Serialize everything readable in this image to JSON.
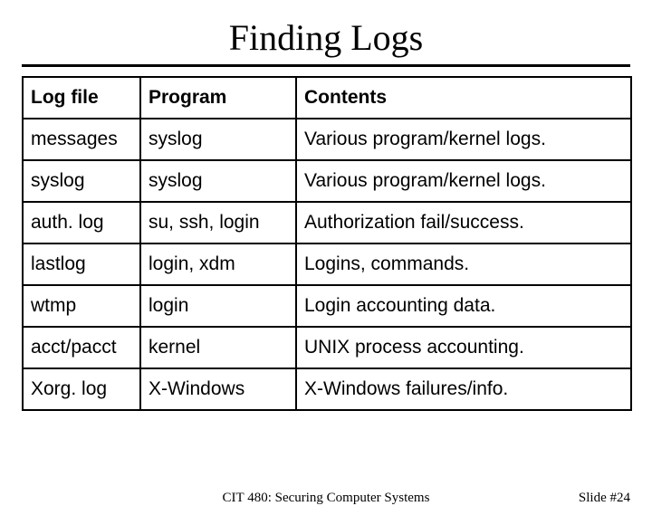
{
  "title": "Finding Logs",
  "table": {
    "headers": [
      "Log file",
      "Program",
      "Contents"
    ],
    "rows": [
      [
        "messages",
        "syslog",
        "Various program/kernel logs."
      ],
      [
        "syslog",
        "syslog",
        "Various program/kernel logs."
      ],
      [
        "auth. log",
        "su, ssh, login",
        "Authorization fail/success."
      ],
      [
        "lastlog",
        "login, xdm",
        "Logins, commands."
      ],
      [
        "wtmp",
        "login",
        "Login accounting data."
      ],
      [
        "acct/pacct",
        "kernel",
        "UNIX process accounting."
      ],
      [
        "Xorg. log",
        "X-Windows",
        "X-Windows failures/info."
      ]
    ]
  },
  "footer": {
    "course": "CIT 480: Securing Computer Systems",
    "slide": "Slide #24"
  }
}
